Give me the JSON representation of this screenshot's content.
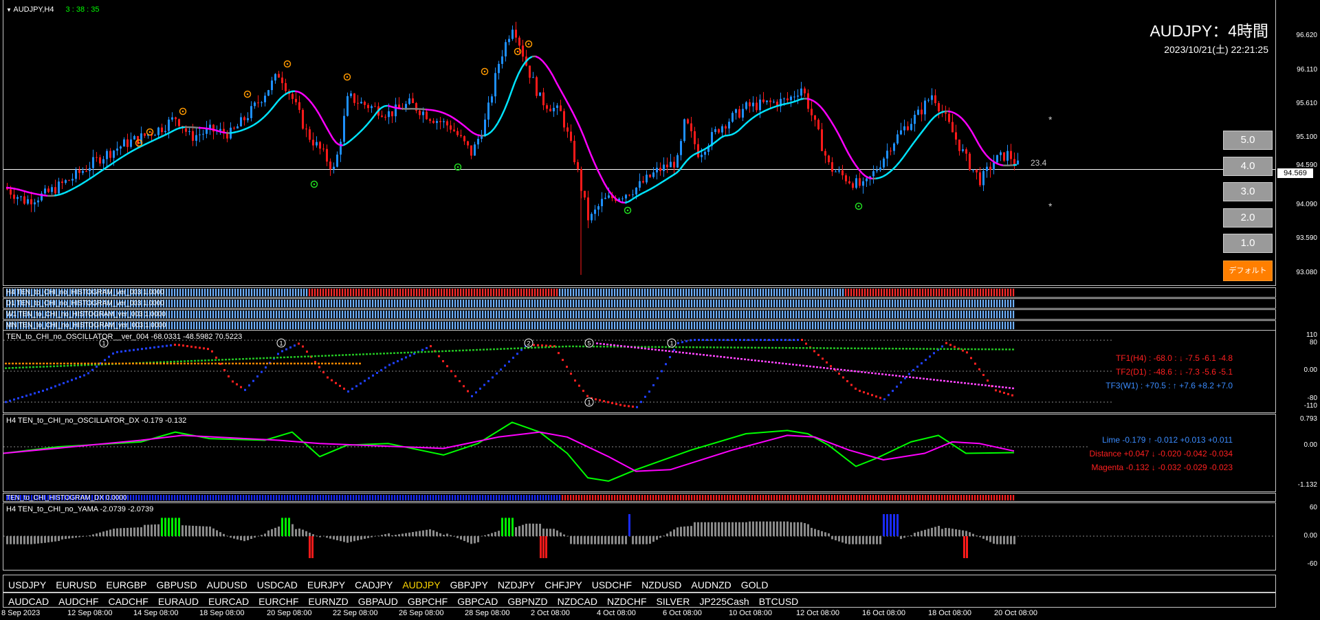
{
  "window": {
    "symbol": "AUDJPY,H4",
    "countdown": "3 : 38 : 35"
  },
  "header": {
    "title": "AUDJPY：4時間",
    "datetime": "2023/10/21(土) 22:21:25"
  },
  "price_scale": [
    "96.620",
    "96.110",
    "95.610",
    "95.100",
    "94.590",
    "94.090",
    "93.590",
    "93.080"
  ],
  "current_price": "94.569",
  "atr_label": "23.4",
  "preset_buttons": [
    "5.0",
    "4.0",
    "3.0",
    "2.0",
    "1.0"
  ],
  "default_button": "デフォルト",
  "histograms": [
    "H4 TEN_to_CHI_no_HISTOGRAM_ver_003 1.0000",
    "D1 TEN_to_CHI_no_HISTOGRAM_ver_003 1.0000",
    "W1 TEN_to_CHI_no_HISTOGRAM_ver_003 1.0000",
    "MN TEN_to_CHI_no_HISTOGRAM_ver_003 1.0000"
  ],
  "oscillator": {
    "title": "TEN_to_CHI_no_OSCILLATOR__ver_004 -68.0331 -48.5982 70.5223",
    "scale": [
      "110",
      "80",
      "0.00",
      "-80",
      "-110"
    ],
    "legend": [
      {
        "text": "TF1(H4) : -68.0 : ↓  -7.5  -6.1  -4.8",
        "color": "#ff2020"
      },
      {
        "text": "TF2(D1) : -48.6 : ↓  -7.3  -5.6  -5.1",
        "color": "#ff2020"
      },
      {
        "text": "TF3(W1) : +70.5 : ↑  +7.6  +8.2  +7.0",
        "color": "#3b8cff"
      }
    ],
    "markers": [
      "1",
      "1",
      "2",
      "5",
      "1",
      "1"
    ]
  },
  "dx": {
    "title": "H4 TEN_to_CHI_no_OSCILLATOR_DX  -0.179 -0.132",
    "scale": [
      "0.793",
      "0.00",
      "-1.132"
    ],
    "legend": [
      {
        "text": "Lime -0.179 ↑  -0.012  +0.013  +0.011",
        "color": "#3b8cff"
      },
      {
        "text": "Distance +0.047 ↓  -0.020  -0.042  -0.034",
        "color": "#ff2020"
      },
      {
        "text": "Magenta -0.132 ↓  -0.032  -0.029  -0.023",
        "color": "#ff2020"
      }
    ]
  },
  "hist_dx": {
    "title": "TEN_to_CHI_HISTOGRAM_DX 0.0000"
  },
  "yama": {
    "title": "H4  TEN_to_CHI_no_YAMA -2.0739 -2.0739",
    "scale": [
      "60",
      "0.00",
      "-60"
    ]
  },
  "symbols_row1": [
    "USDJPY",
    "EURUSD",
    "EURGBP",
    "GBPUSD",
    "AUDUSD",
    "USDCAD",
    "EURJPY",
    "CADJPY",
    "AUDJPY",
    "GBPJPY",
    "NZDJPY",
    "CHFJPY",
    "USDCHF",
    "NZDUSD",
    "AUDNZD",
    "GOLD"
  ],
  "symbols_row2": [
    "AUDCAD",
    "AUDCHF",
    "CADCHF",
    "EURAUD",
    "EURCAD",
    "EURCHF",
    "EURNZD",
    "GBPAUD",
    "GBPCHF",
    "GBPCAD",
    "GBPNZD",
    "NZDCAD",
    "NZDCHF",
    "SILVER",
    "JP225Cash",
    "BTCUSD"
  ],
  "active_symbol": "AUDJPY",
  "time_axis": [
    "8 Sep 2023",
    "12 Sep 08:00",
    "14 Sep 08:00",
    "18 Sep 08:00",
    "20 Sep 08:00",
    "22 Sep 08:00",
    "26 Sep 08:00",
    "28 Sep 08:00",
    "2 Oct 08:00",
    "4 Oct 08:00",
    "6 Oct 08:00",
    "10 Oct 08:00",
    "12 Oct 08:00",
    "16 Oct 08:00",
    "18 Oct 08:00",
    "20 Oct 08:00"
  ],
  "colors": {
    "bull": "#1e90ff",
    "bear": "#ff1a1a",
    "ma_rise": "#00e5ff",
    "ma_fall": "#ff00ff",
    "ma_flat": "#808080",
    "lime": "#00ff00",
    "grid": "#c8c8c8"
  }
}
